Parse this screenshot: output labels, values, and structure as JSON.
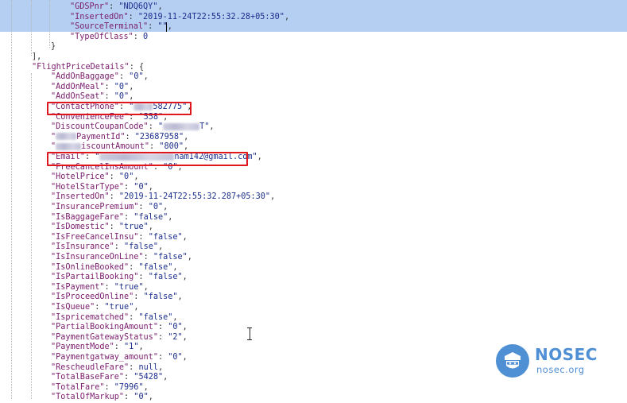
{
  "lines": [
    {
      "indent": 3,
      "key": "GDSPnr",
      "val": "NDQ6QY",
      "type": "str",
      "comma": true
    },
    {
      "indent": 3,
      "key": "InsertedOn",
      "val": "2019-11-24T22:55:32.28+05:30",
      "type": "str",
      "comma": true
    },
    {
      "indent": 3,
      "key": "SourceTerminal",
      "val": "",
      "type": "str",
      "comma": true
    },
    {
      "indent": 3,
      "key": "TypeOfClass",
      "val": "0",
      "type": "num",
      "comma": false
    },
    {
      "indent": 2,
      "text": "}"
    },
    {
      "indent": 1,
      "text": "],"
    },
    {
      "indent": 1,
      "key": "FlightPriceDetails",
      "text": "{",
      "type": "open"
    },
    {
      "indent": 2,
      "key": "AddOnBaggage",
      "val": "0",
      "type": "str",
      "comma": true
    },
    {
      "indent": 2,
      "key": "AddOnMeal",
      "val": "0",
      "type": "str",
      "comma": true
    },
    {
      "indent": 2,
      "key": "AddOnSeat",
      "val": "0",
      "type": "str",
      "comma": true
    },
    {
      "indent": 2,
      "key": "ContactPhone",
      "val": "582775",
      "blurPre": 24,
      "type": "str",
      "comma": true
    },
    {
      "indent": 2,
      "key": "ConvenienceFee",
      "val": "558",
      "type": "str",
      "comma": true
    },
    {
      "indent": 2,
      "key": "DiscountCoupanCode",
      "val": "T",
      "blurPre": 46,
      "type": "str",
      "comma": true
    },
    {
      "indent": 2,
      "key": "PaymentId",
      "keyBlur": 26,
      "val": "23687958",
      "type": "str",
      "comma": true
    },
    {
      "indent": 2,
      "key": "iscountAmount",
      "keyBlur": 32,
      "val": "800",
      "type": "str",
      "comma": true
    },
    {
      "indent": 2,
      "key": "Email",
      "val": "nam142@gmail.com",
      "blurPre": 94,
      "type": "str",
      "comma": true
    },
    {
      "indent": 2,
      "key": "FreeCancelInsAmount",
      "val": "0",
      "type": "str",
      "comma": true
    },
    {
      "indent": 2,
      "key": "HotelPrice",
      "val": "0",
      "type": "str",
      "comma": true
    },
    {
      "indent": 2,
      "key": "HotelStarType",
      "val": "0",
      "type": "str",
      "comma": true
    },
    {
      "indent": 2,
      "key": "InsertedOn",
      "val": "2019-11-24T22:55:32.287+05:30",
      "type": "str",
      "comma": true
    },
    {
      "indent": 2,
      "key": "InsurancePremium",
      "val": "0",
      "type": "str",
      "comma": true
    },
    {
      "indent": 2,
      "key": "IsBaggageFare",
      "val": "false",
      "type": "str",
      "comma": true
    },
    {
      "indent": 2,
      "key": "IsDomestic",
      "val": "true",
      "type": "str",
      "comma": true
    },
    {
      "indent": 2,
      "key": "IsFreeCancelInsu",
      "val": "false",
      "type": "str",
      "comma": true
    },
    {
      "indent": 2,
      "key": "IsInsurance",
      "val": "false",
      "type": "str",
      "comma": true
    },
    {
      "indent": 2,
      "key": "IsInsuranceOnLine",
      "val": "false",
      "type": "str",
      "comma": true
    },
    {
      "indent": 2,
      "key": "IsOnlineBooked",
      "val": "false",
      "type": "str",
      "comma": true
    },
    {
      "indent": 2,
      "key": "IsPartailBooking",
      "val": "false",
      "type": "str",
      "comma": true
    },
    {
      "indent": 2,
      "key": "IsPayment",
      "val": "true",
      "type": "str",
      "comma": true
    },
    {
      "indent": 2,
      "key": "IsProceedOnline",
      "val": "false",
      "type": "str",
      "comma": true
    },
    {
      "indent": 2,
      "key": "IsQueue",
      "val": "true",
      "type": "str",
      "comma": true
    },
    {
      "indent": 2,
      "key": "Ispricematched",
      "val": "false",
      "type": "str",
      "comma": true
    },
    {
      "indent": 2,
      "key": "PartialBookingAmount",
      "val": "0",
      "type": "str",
      "comma": true
    },
    {
      "indent": 2,
      "key": "PaymentGatewayStatus",
      "val": "2",
      "type": "str",
      "comma": true
    },
    {
      "indent": 2,
      "key": "PaymentMode",
      "val": "1",
      "type": "str",
      "comma": true
    },
    {
      "indent": 2,
      "key": "Paymentgatway_amount",
      "val": "0",
      "type": "str",
      "comma": true
    },
    {
      "indent": 2,
      "key": "RescheudleFare",
      "val": "null",
      "type": "num",
      "comma": true
    },
    {
      "indent": 2,
      "key": "TotalBaseFare",
      "val": "5428",
      "type": "str",
      "comma": true
    },
    {
      "indent": 2,
      "key": "TotalFare",
      "val": "7996",
      "type": "str",
      "comma": true
    },
    {
      "indent": 2,
      "key": "TotalOfMarkup",
      "val": "0",
      "type": "str",
      "comma": true
    }
  ],
  "highlighted_keys": [
    "ContactPhone",
    "Email"
  ],
  "selection_color": "#b4cff2",
  "highlight_color": "#e0161f",
  "logo": {
    "brand": "NOSEC",
    "domain": "nosec.org",
    "color": "#4f8fd4"
  }
}
